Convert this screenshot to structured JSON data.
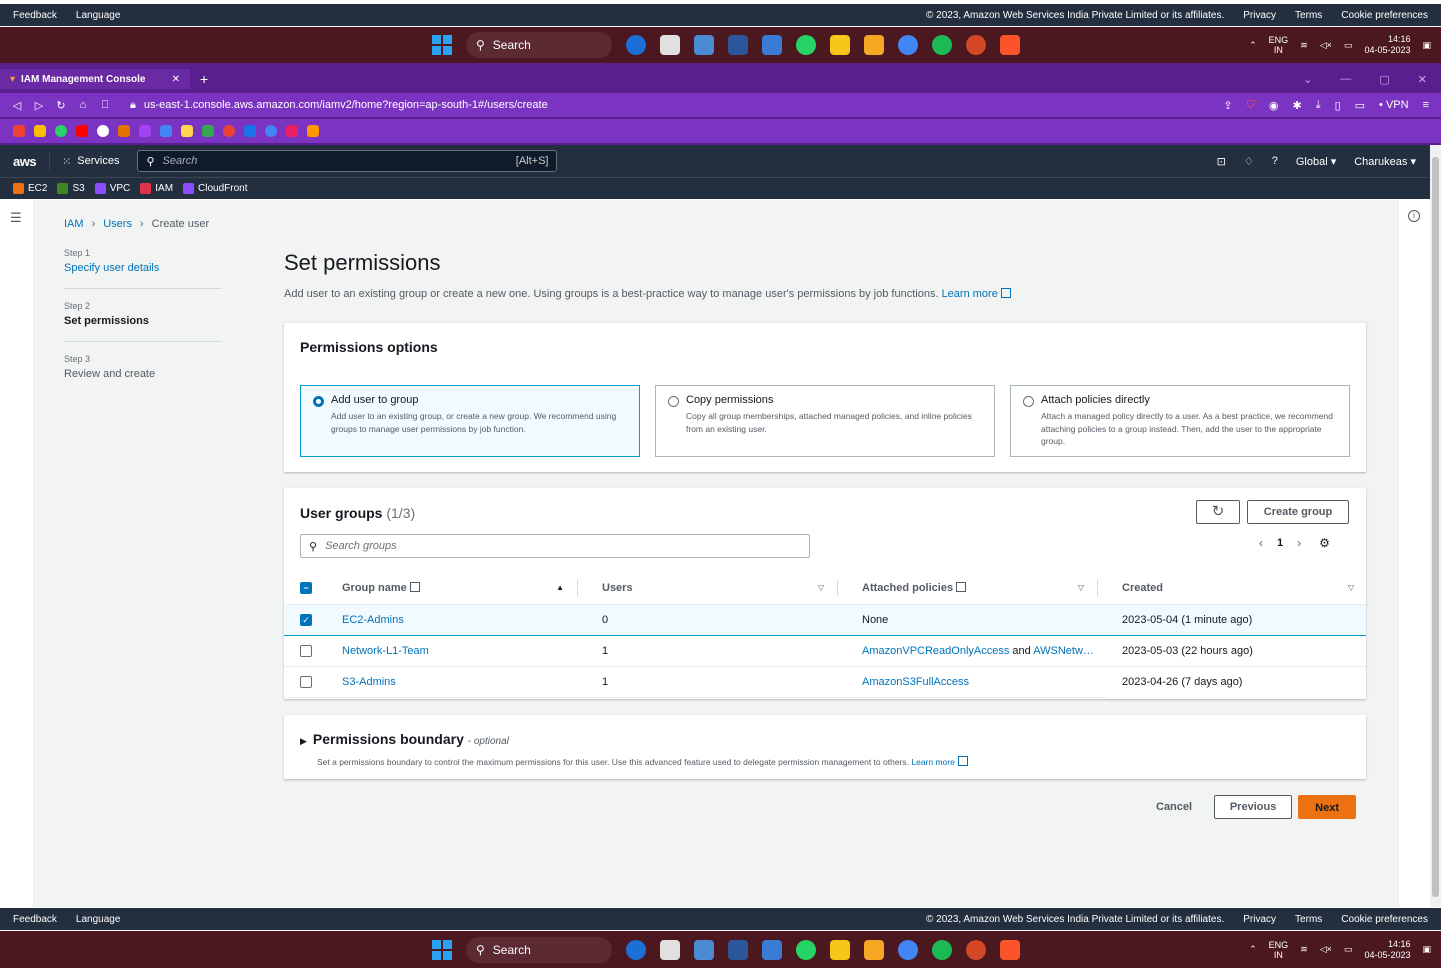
{
  "footer": {
    "feedback": "Feedback",
    "language": "Language",
    "copyright": "© 2023, Amazon Web Services India Private Limited or its affiliates.",
    "privacy": "Privacy",
    "terms": "Terms",
    "cookie": "Cookie preferences"
  },
  "taskbar": {
    "search": "Search",
    "lang1": "ENG",
    "lang2": "IN",
    "time": "14:16",
    "date": "04-05-2023"
  },
  "browser": {
    "tab_title": "IAM Management Console",
    "url": "us-east-1.console.aws.amazon.com/iamv2/home?region=ap-south-1#/users/create",
    "vpn": "• VPN"
  },
  "aws": {
    "logo": "aws",
    "services": "Services",
    "search_placeholder": "Search",
    "search_shortcut": "[Alt+S]",
    "region": "Global ▾",
    "account": "Charukeas ▾",
    "favorites": [
      "EC2",
      "S3",
      "VPC",
      "IAM",
      "CloudFront"
    ],
    "favorite_colors": [
      "#ec7211",
      "#3f8624",
      "#8c4fff",
      "#dd344c",
      "#8c4fff"
    ]
  },
  "breadcrumb": {
    "iam": "IAM",
    "users": "Users",
    "current": "Create user"
  },
  "steps": [
    {
      "label": "Step 1",
      "name": "Specify user details"
    },
    {
      "label": "Step 2",
      "name": "Set permissions"
    },
    {
      "label": "Step 3",
      "name": "Review and create"
    }
  ],
  "page": {
    "title": "Set permissions",
    "desc": "Add user to an existing group or create a new one. Using groups is a best-practice way to manage user's permissions by job functions.",
    "learn_more": "Learn more"
  },
  "perm_options": {
    "title": "Permissions options",
    "options": [
      {
        "title": "Add user to group",
        "desc": "Add user to an existing group, or create a new group. We recommend using groups to manage user permissions by job function."
      },
      {
        "title": "Copy permissions",
        "desc": "Copy all group memberships, attached managed policies, and inline policies from an existing user."
      },
      {
        "title": "Attach policies directly",
        "desc": "Attach a managed policy directly to a user. As a best practice, we recommend attaching policies to a group instead. Then, add the user to the appropriate group."
      }
    ]
  },
  "groups": {
    "title": "User groups",
    "count": "(1/3)",
    "create": "Create group",
    "search_placeholder": "Search groups",
    "page": "1",
    "columns": {
      "name": "Group name",
      "users": "Users",
      "policies": "Attached policies",
      "created": "Created"
    },
    "rows": [
      {
        "name": "EC2-Admins",
        "users": "0",
        "policy1": "None",
        "and": "",
        "policy2": "",
        "created": "2023-05-04 (1 minute ago)"
      },
      {
        "name": "Network-L1-Team",
        "users": "1",
        "policy1": "AmazonVPCReadOnlyAccess",
        "and": " and ",
        "policy2": "AWSNetw…",
        "created": "2023-05-03 (22 hours ago)"
      },
      {
        "name": "S3-Admins",
        "users": "1",
        "policy1": "AmazonS3FullAccess",
        "and": "",
        "policy2": "",
        "created": "2023-04-26 (7 days ago)"
      }
    ]
  },
  "boundary": {
    "title": "Permissions boundary",
    "optional": "- optional",
    "desc": "Set a permissions boundary to control the maximum permissions for this user. Use this advanced feature used to delegate permission management to others.",
    "learn_more": "Learn more"
  },
  "actions": {
    "cancel": "Cancel",
    "previous": "Previous",
    "next": "Next"
  }
}
